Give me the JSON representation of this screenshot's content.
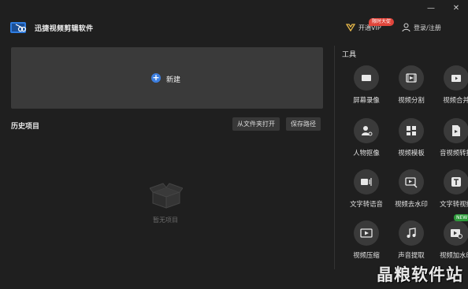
{
  "app": {
    "title": "迅捷视频剪辑软件",
    "vip_label": "开通VIP",
    "vip_badge": "限时大促",
    "login_label": "登录/注册"
  },
  "window_controls": {
    "minimize": "—",
    "close": "✕"
  },
  "new_project": {
    "label": "新建"
  },
  "history": {
    "title": "历史项目",
    "open_folder_label": "从文件夹打开",
    "save_path_label": "保存路径",
    "empty_text": "暂无项目"
  },
  "tools": {
    "title": "工具",
    "items": [
      {
        "label": "屏幕录像",
        "icon": "screen-record-icon"
      },
      {
        "label": "视频分割",
        "icon": "video-split-icon"
      },
      {
        "label": "视频合并",
        "icon": "video-merge-icon"
      },
      {
        "label": "人物抠像",
        "icon": "portrait-cutout-icon"
      },
      {
        "label": "视频模板",
        "icon": "video-template-icon"
      },
      {
        "label": "音视频转换",
        "icon": "av-convert-icon"
      },
      {
        "label": "文字转语音",
        "icon": "text-to-speech-icon"
      },
      {
        "label": "视频去水印",
        "icon": "remove-watermark-icon"
      },
      {
        "label": "文字转视频",
        "icon": "text-to-video-icon"
      },
      {
        "label": "视频压缩",
        "icon": "video-compress-icon"
      },
      {
        "label": "声音提取",
        "icon": "audio-extract-icon"
      },
      {
        "label": "视频加水印",
        "icon": "add-watermark-icon",
        "badge": "NEW"
      }
    ]
  },
  "watermark": "晶粮软件站",
  "colors": {
    "background": "#1f1f1f",
    "card": "#3a3a3a",
    "accent_blue": "#3d7fe0",
    "badge_red": "#e0453b",
    "badge_green": "#2e9b3b"
  }
}
